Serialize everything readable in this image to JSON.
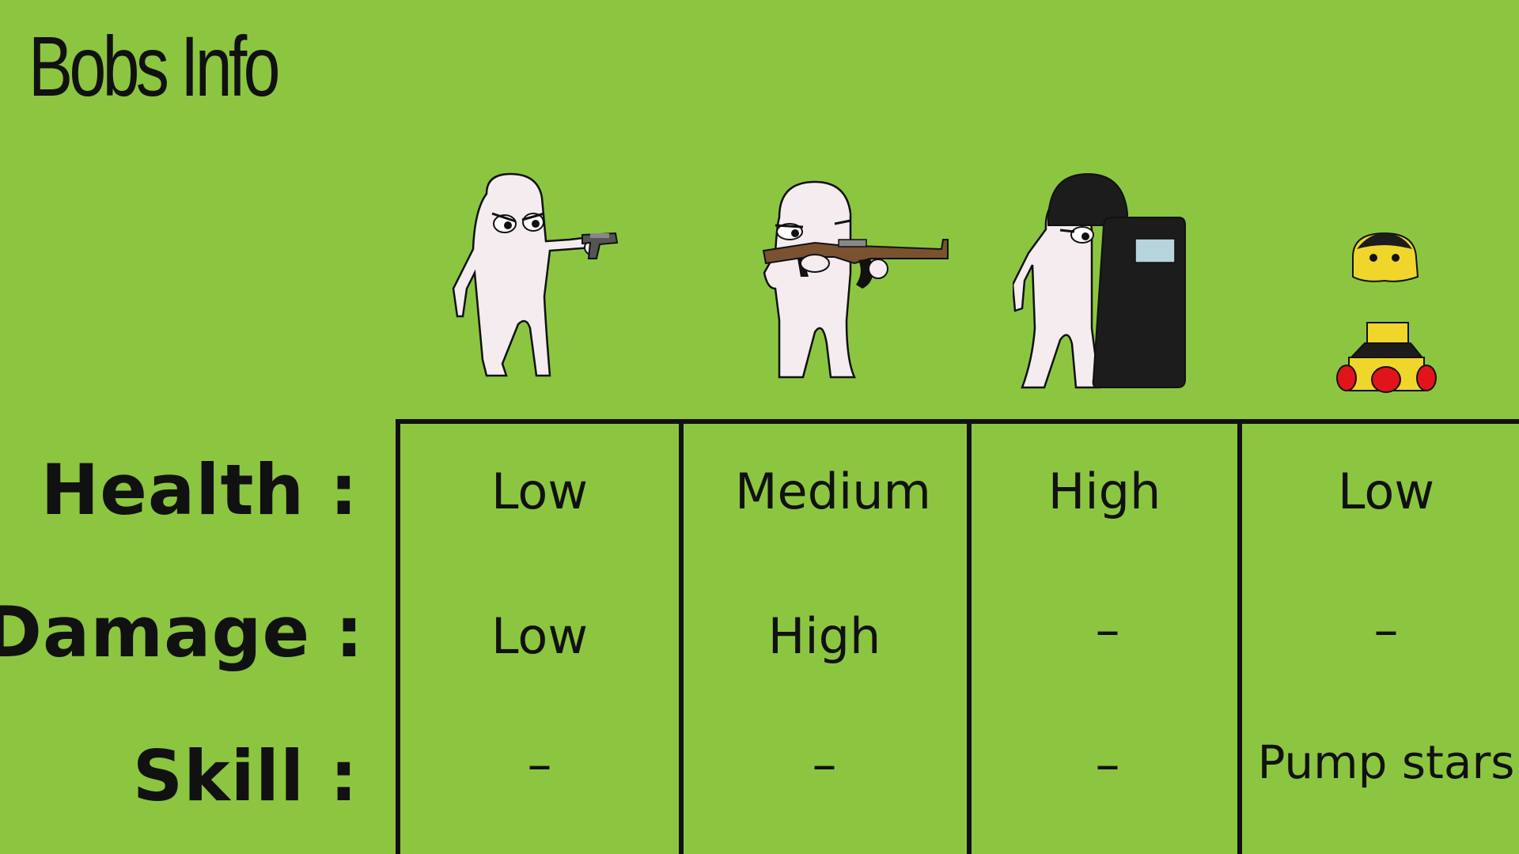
{
  "title": "Bobs Info",
  "rows": {
    "health_label": "Health :",
    "damage_label": "Damage :",
    "skill_label": "Skill :"
  },
  "characters": [
    {
      "icon": "pistol-bob-icon",
      "health": "Low",
      "damage": "Low",
      "skill": "–"
    },
    {
      "icon": "rifle-bob-icon",
      "health": "Medium",
      "damage": "High",
      "skill": "–"
    },
    {
      "icon": "shield-bob-icon",
      "health": "High",
      "damage": "–",
      "skill": "–"
    },
    {
      "icon": "pump-star-bob-icon",
      "health": "Low",
      "damage": "–",
      "skill": "Pump stars"
    }
  ],
  "colors": {
    "background": "#8cc641",
    "line": "#111111",
    "bob_body": "#f4ecee",
    "shield": "#1c1c1c",
    "rifle_wood": "#7a5230",
    "yellow": "#f0d62a",
    "red": "#e0141a"
  }
}
